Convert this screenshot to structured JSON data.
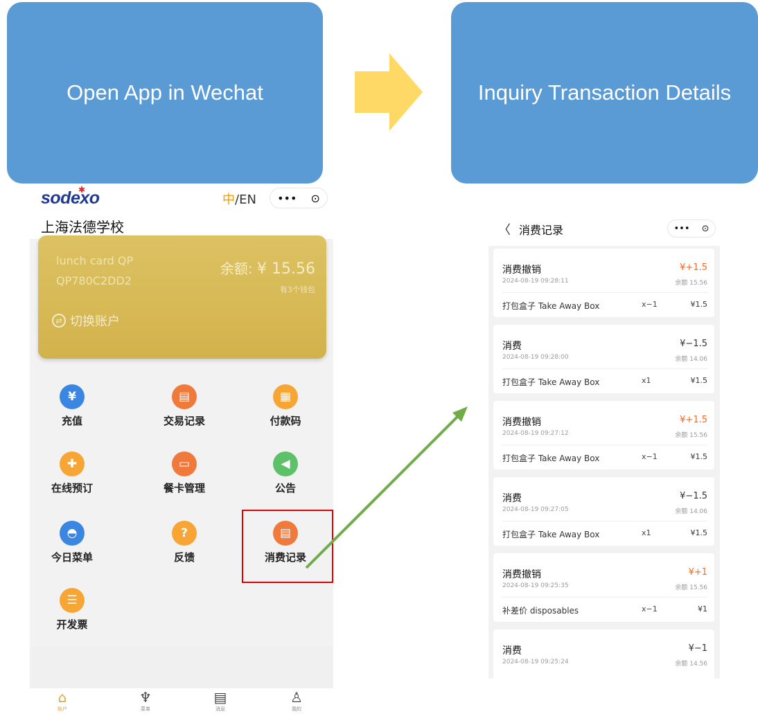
{
  "steps": {
    "step1_label": "Open App in Wechat",
    "step2_label": "Inquiry Transaction Details"
  },
  "colors": {
    "step_box": "#5b9bd5",
    "flow_arrow": "#ffd966",
    "link_arrow": "#70ad47",
    "highlight": "#e00000",
    "card_gold": "#d4b450",
    "positive_amount": "#ee6a2a"
  },
  "home": {
    "logo": "sodexo",
    "lang_zh": "中",
    "lang_rest": "/EN",
    "capsule_more": "•••",
    "capsule_close": "⊙",
    "school": "上海法德学校",
    "card": {
      "name": "lunch card QP",
      "id": "QP780C2DD2",
      "balance_label": "余额:",
      "balance_value": "¥ 15.56",
      "wallets": "有3个钱包",
      "switch_label": "切换账户"
    },
    "grid": [
      {
        "label": "充值",
        "icon": "recharge-icon",
        "color": "#3b86e0"
      },
      {
        "label": "交易记录",
        "icon": "transaction-record-icon",
        "color": "#f07a3c"
      },
      {
        "label": "付款码",
        "icon": "qr-code-icon",
        "color": "#f7a534"
      },
      {
        "label": "在线预订",
        "icon": "cutlery-icon",
        "color": "#f7a534"
      },
      {
        "label": "餐卡管理",
        "icon": "card-icon",
        "color": "#f07a3c"
      },
      {
        "label": "公告",
        "icon": "megaphone-icon",
        "color": "#5cc168"
      },
      {
        "label": "今日菜单",
        "icon": "cloche-icon",
        "color": "#3b86e0"
      },
      {
        "label": "反馈",
        "icon": "feedback-icon",
        "color": "#f7a534"
      },
      {
        "label": "消费记录",
        "icon": "consumption-record-icon",
        "color": "#f07a3c"
      },
      {
        "label": "开发票",
        "icon": "invoice-icon",
        "color": "#f7a534"
      }
    ],
    "tabs": [
      {
        "label": "账户",
        "icon": "home-icon"
      },
      {
        "label": "菜单",
        "icon": "utensils-icon"
      },
      {
        "label": "消息",
        "icon": "clipboard-icon"
      },
      {
        "label": "我的",
        "icon": "user-icon"
      }
    ]
  },
  "records": {
    "title": "消费记录",
    "back": "〈",
    "capsule_more": "•••",
    "capsule_close": "⊙",
    "transactions": [
      {
        "type": "消费撤销",
        "amount": "¥+1.5",
        "date": "2024-08-19 09:28:11",
        "balance": "余额 15.56",
        "item": "打包盒子 Take Away Box",
        "qty": "x−1",
        "price": "¥1.5"
      },
      {
        "type": "消费",
        "amount": "¥−1.5",
        "date": "2024-08-19 09:28:00",
        "balance": "余额 14.06",
        "item": "打包盒子 Take Away Box",
        "qty": "x1",
        "price": "¥1.5"
      },
      {
        "type": "消费撤销",
        "amount": "¥+1.5",
        "date": "2024-08-19 09:27:12",
        "balance": "余额 15.56",
        "item": "打包盒子 Take Away Box",
        "qty": "x−1",
        "price": "¥1.5"
      },
      {
        "type": "消费",
        "amount": "¥−1.5",
        "date": "2024-08-19 09:27:05",
        "balance": "余额 14.06",
        "item": "打包盒子 Take Away Box",
        "qty": "x1",
        "price": "¥1.5"
      },
      {
        "type": "消费撤销",
        "amount": "¥+1",
        "date": "2024-08-19 09:25:35",
        "balance": "余额 15.56",
        "item": "补差价 disposables",
        "qty": "x−1",
        "price": "¥1"
      },
      {
        "type": "消费",
        "amount": "¥−1",
        "date": "2024-08-19 09:25:24",
        "balance": "余额 14.56",
        "item": "",
        "qty": "",
        "price": ""
      }
    ]
  }
}
